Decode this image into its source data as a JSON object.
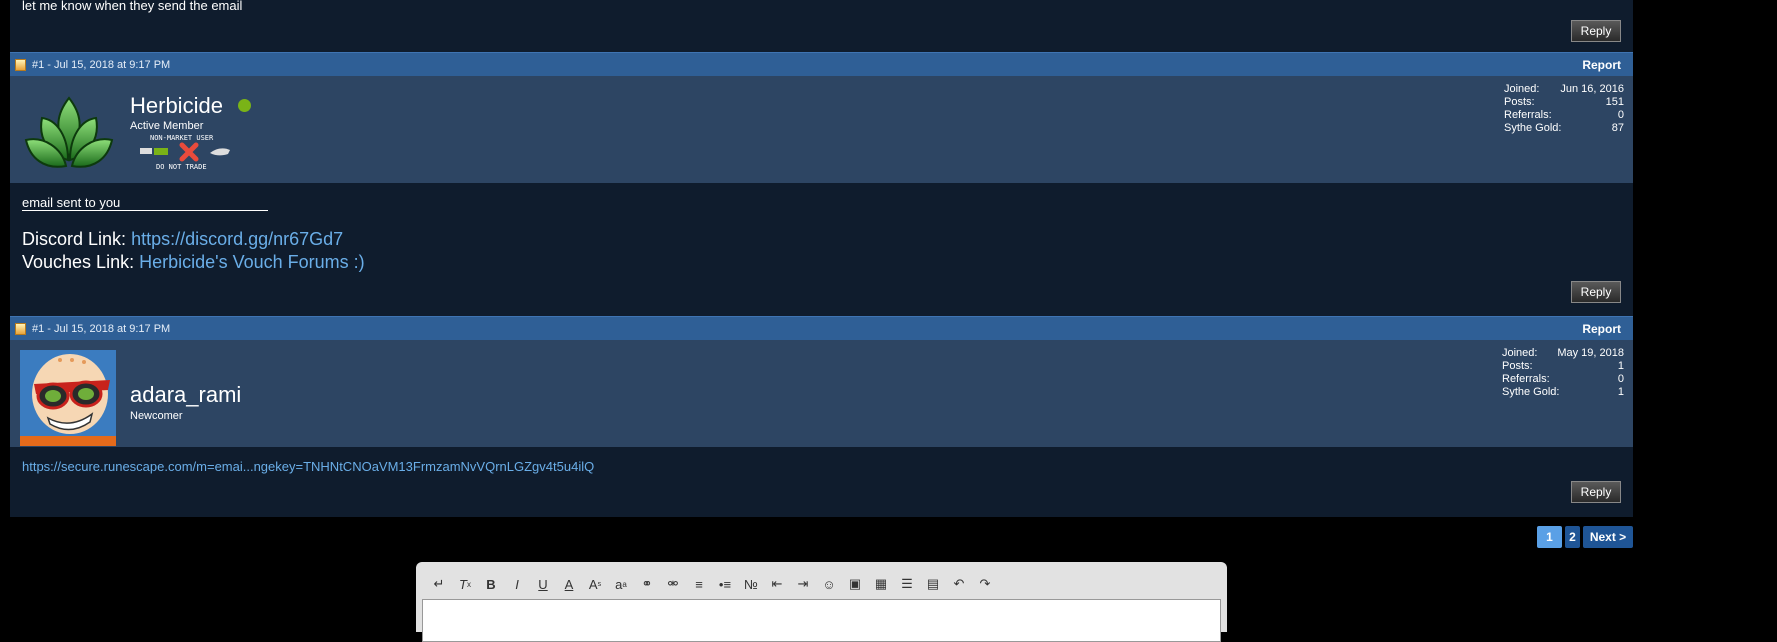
{
  "prev_post": {
    "text": "let me know when they send the email",
    "reply_label": "Reply"
  },
  "post1": {
    "header": "#1 - Jul 15, 2018 at 9:17 PM",
    "report_label": "Report",
    "username": "Herbicide",
    "rank": "Active Member",
    "badge_top": "NON-MARKET USER",
    "badge_bottom": "DO NOT TRADE",
    "stats": [
      {
        "label": "Joined:",
        "value": "Jun 16, 2016"
      },
      {
        "label": "Posts:",
        "value": "151"
      },
      {
        "label": "Referrals:",
        "value": "0"
      },
      {
        "label": "Sythe Gold:",
        "value": "87"
      }
    ],
    "body_text": "email sent to you",
    "signature_line": "____________________",
    "discord_label": "Discord Link:",
    "discord_url": "https://discord.gg/nr67Gd7",
    "vouches_label": "Vouches Link:",
    "vouches_text": "Herbicide's Vouch Forums :)",
    "reply_label": "Reply"
  },
  "post2": {
    "header": "#1 - Jul 15, 2018 at 9:17 PM",
    "report_label": "Report",
    "username": "adara_rami",
    "rank": "Newcomer",
    "stats": [
      {
        "label": "Joined:",
        "value": "May 19, 2018"
      },
      {
        "label": "Posts:",
        "value": "1"
      },
      {
        "label": "Referrals:",
        "value": "0"
      },
      {
        "label": "Sythe Gold:",
        "value": "1"
      }
    ],
    "body_link": "https://secure.runescape.com/m=emai...ngekey=TNHNtCNOaVM13FrmzamNvVQrnLGZgv4t5u4ilQ",
    "reply_label": "Reply"
  },
  "pagination": {
    "pages": [
      "1",
      "2"
    ],
    "current": "1",
    "next_label": "Next >"
  },
  "colors": {
    "header_bar": "#2f5f96",
    "user_bar": "#2d4563",
    "body_bg": "#0f1c2d",
    "link": "#6aaee8",
    "online": "#7ab317"
  },
  "editor": {
    "toolbar_icons": [
      "insert-icon",
      "remove-format-icon",
      "bold-icon",
      "italic-icon",
      "underline-icon",
      "font-color-icon",
      "font-size-icon",
      "font-family-icon",
      "link-icon",
      "unlink-icon",
      "align-icon",
      "bullet-list-icon",
      "number-list-icon",
      "outdent-icon",
      "indent-icon",
      "smilie-icon",
      "image-icon",
      "media-icon",
      "quote-icon",
      "save-draft-icon",
      "undo-icon",
      "redo-icon"
    ]
  }
}
